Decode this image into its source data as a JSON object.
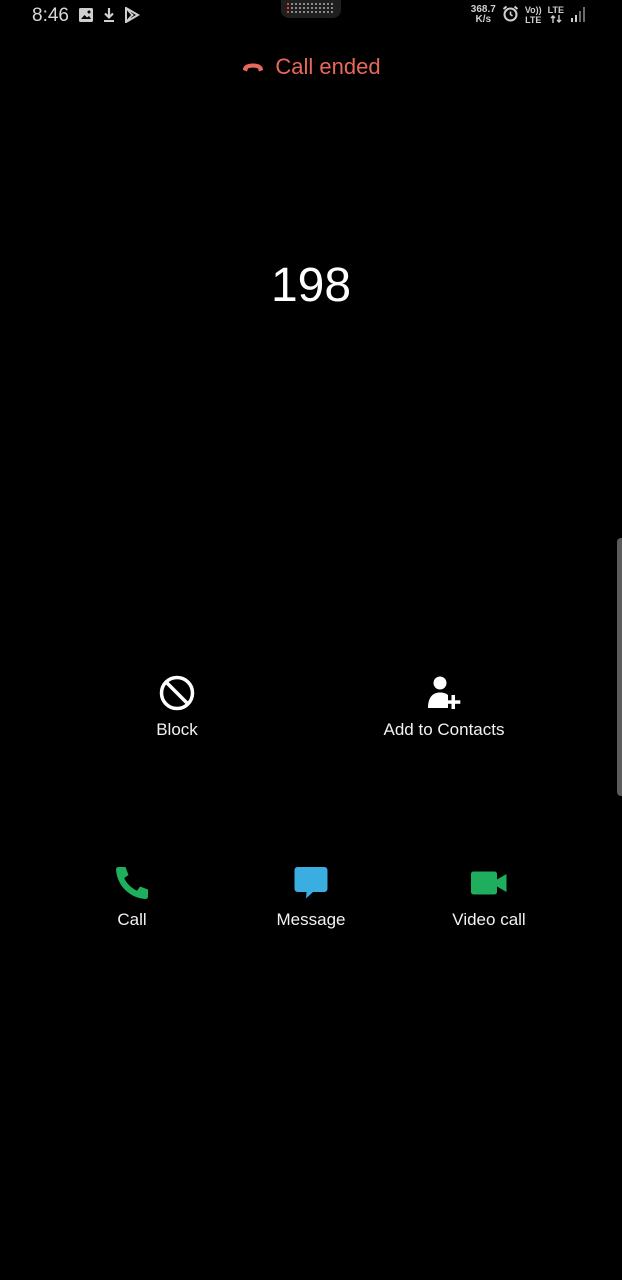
{
  "status_bar": {
    "time": "8:46",
    "left_icons": [
      "image-icon",
      "download-icon",
      "play-store-icon"
    ],
    "net_speed_value": "368.7",
    "net_speed_unit": "K/s",
    "right_icons": [
      "alarm-icon",
      "volte-icon",
      "lte-data-icon",
      "signal-icon"
    ],
    "volte_top": "Vo))",
    "volte_bottom": "LTE",
    "lte_top": "LTE"
  },
  "call": {
    "status_text": "Call ended",
    "status_color": "#e9685c",
    "number": "198"
  },
  "actions_top": {
    "block_label": "Block",
    "add_contact_label": "Add to Contacts"
  },
  "actions_bottom": {
    "call_label": "Call",
    "message_label": "Message",
    "video_label": "Video call",
    "call_color": "#1fae5e",
    "message_color": "#3aaee0",
    "video_color": "#1fae5e"
  }
}
